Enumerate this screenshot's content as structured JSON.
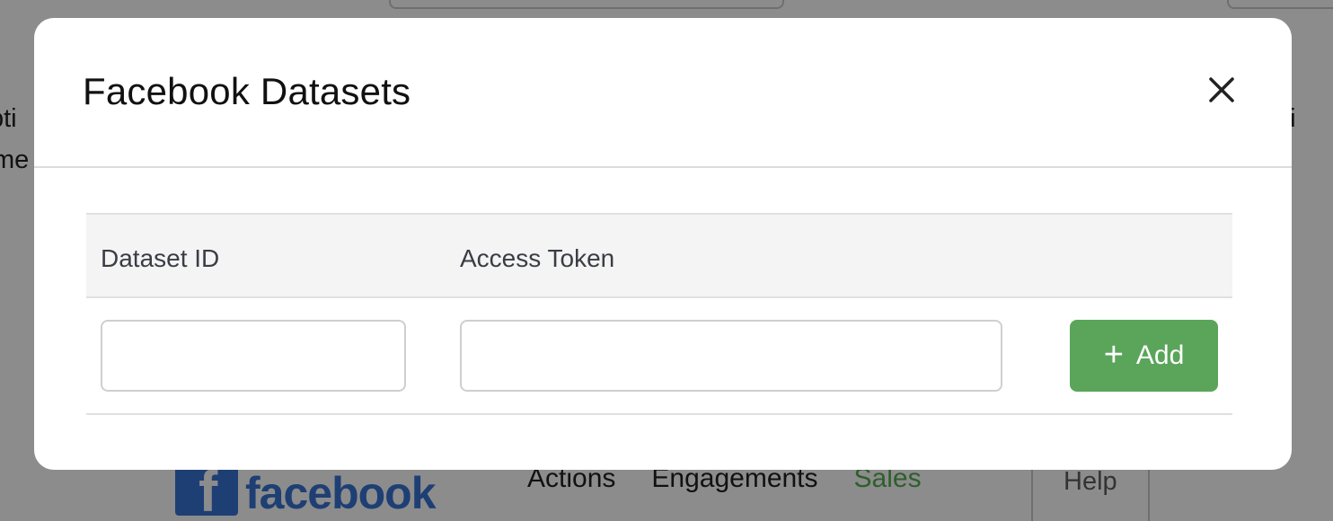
{
  "background": {
    "left_text_1": "pti",
    "left_text_2": "me",
    "right_text_1": "pti",
    "logo_word": "facebook",
    "nav": [
      "Actions",
      "Engagements",
      "Sales"
    ],
    "help": "Help",
    "active_color": "#2d5f2d"
  },
  "modal": {
    "title": "Facebook Datasets",
    "close_label": "X",
    "table": {
      "headers": [
        "Dataset ID",
        "Access Token"
      ],
      "row": {
        "dataset_id": {
          "value": "",
          "placeholder": ""
        },
        "access_token": {
          "value": "",
          "placeholder": ""
        },
        "add_icon": "plus-icon",
        "add_label": "Add"
      }
    },
    "accent_color": "#5aa55a"
  }
}
